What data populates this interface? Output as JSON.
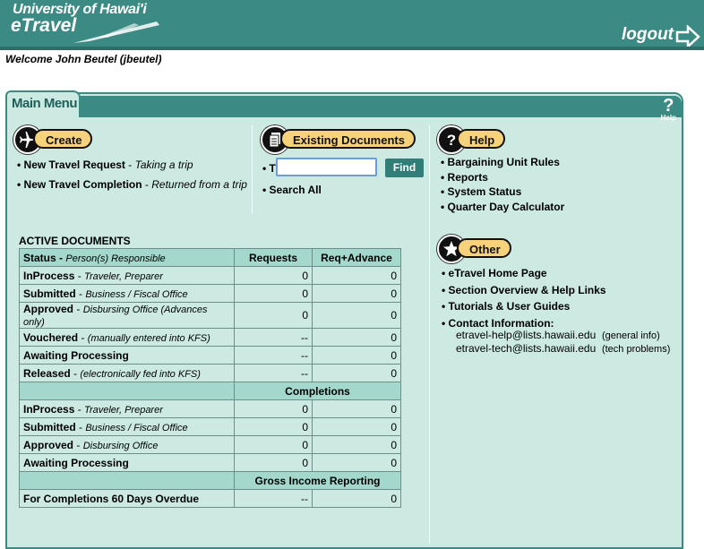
{
  "header": {
    "brand_line1": "University of Hawai'i",
    "brand_line2": "eTravel",
    "logout_label": "logout"
  },
  "welcome": "Welcome John Beutel (jbeutel)",
  "main_tab": {
    "label": "Main Menu",
    "help_label": "Help"
  },
  "create": {
    "title": "Create",
    "items": [
      {
        "label": "New Travel Request",
        "desc": "Taking a trip"
      },
      {
        "label": "New Travel Completion",
        "desc": "Returned from a trip"
      }
    ]
  },
  "existing": {
    "title": "Existing Documents",
    "find_prefix": "T",
    "search_value": "",
    "find_label": "Find",
    "search_all": "Search All"
  },
  "help": {
    "title": "Help",
    "items": [
      "Bargaining Unit Rules",
      "Reports",
      "System Status",
      "Quarter Day Calculator"
    ]
  },
  "other": {
    "title": "Other",
    "items": [
      "eTravel Home Page",
      "Section Overview & Help Links",
      "Tutorials & User Guides",
      "Contact Information:"
    ],
    "contacts": [
      {
        "email": "etravel-help@lists.hawaii.edu",
        "note": "(general info)"
      },
      {
        "email": "etravel-tech@lists.hawaii.edu",
        "note": "(tech problems)"
      }
    ]
  },
  "active_documents": {
    "title": "ACTIVE DOCUMENTS",
    "header": {
      "status": "Status",
      "status_desc": "Person(s) Responsible",
      "col2": "Requests",
      "col3": "Req+Advance"
    },
    "rows": [
      {
        "name": "InProcess",
        "desc": "Traveler, Preparer",
        "v1": "0",
        "v2": "0"
      },
      {
        "name": "Submitted",
        "desc": "Business / Fiscal Office",
        "v1": "0",
        "v2": "0"
      },
      {
        "name": "Approved",
        "desc": "Disbursing Office (Advances only)",
        "v1": "0",
        "v2": "0"
      },
      {
        "name": "Vouchered",
        "desc": "(manually entered into KFS)",
        "v1": "--",
        "v2": "0"
      },
      {
        "name": "Awaiting Processing",
        "desc": "",
        "v1": "--",
        "v2": "0"
      },
      {
        "name": "Released",
        "desc": "(electronically fed into KFS)",
        "v1": "--",
        "v2": "0"
      }
    ],
    "completions_label": "Completions",
    "completion_rows": [
      {
        "name": "InProcess",
        "desc": "Traveler, Preparer",
        "v1": "0",
        "v2": "0"
      },
      {
        "name": "Submitted",
        "desc": "Business / Fiscal Office",
        "v1": "0",
        "v2": "0"
      },
      {
        "name": "Approved",
        "desc": "Disbursing Office",
        "v1": "0",
        "v2": "0"
      },
      {
        "name": "Awaiting Processing",
        "desc": "",
        "v1": "0",
        "v2": "0"
      }
    ],
    "gross_label": "Gross Income Reporting",
    "gross_rows": [
      {
        "name": "For Completions 60 Days Overdue",
        "desc": "",
        "v1": "--",
        "v2": "0"
      }
    ]
  }
}
